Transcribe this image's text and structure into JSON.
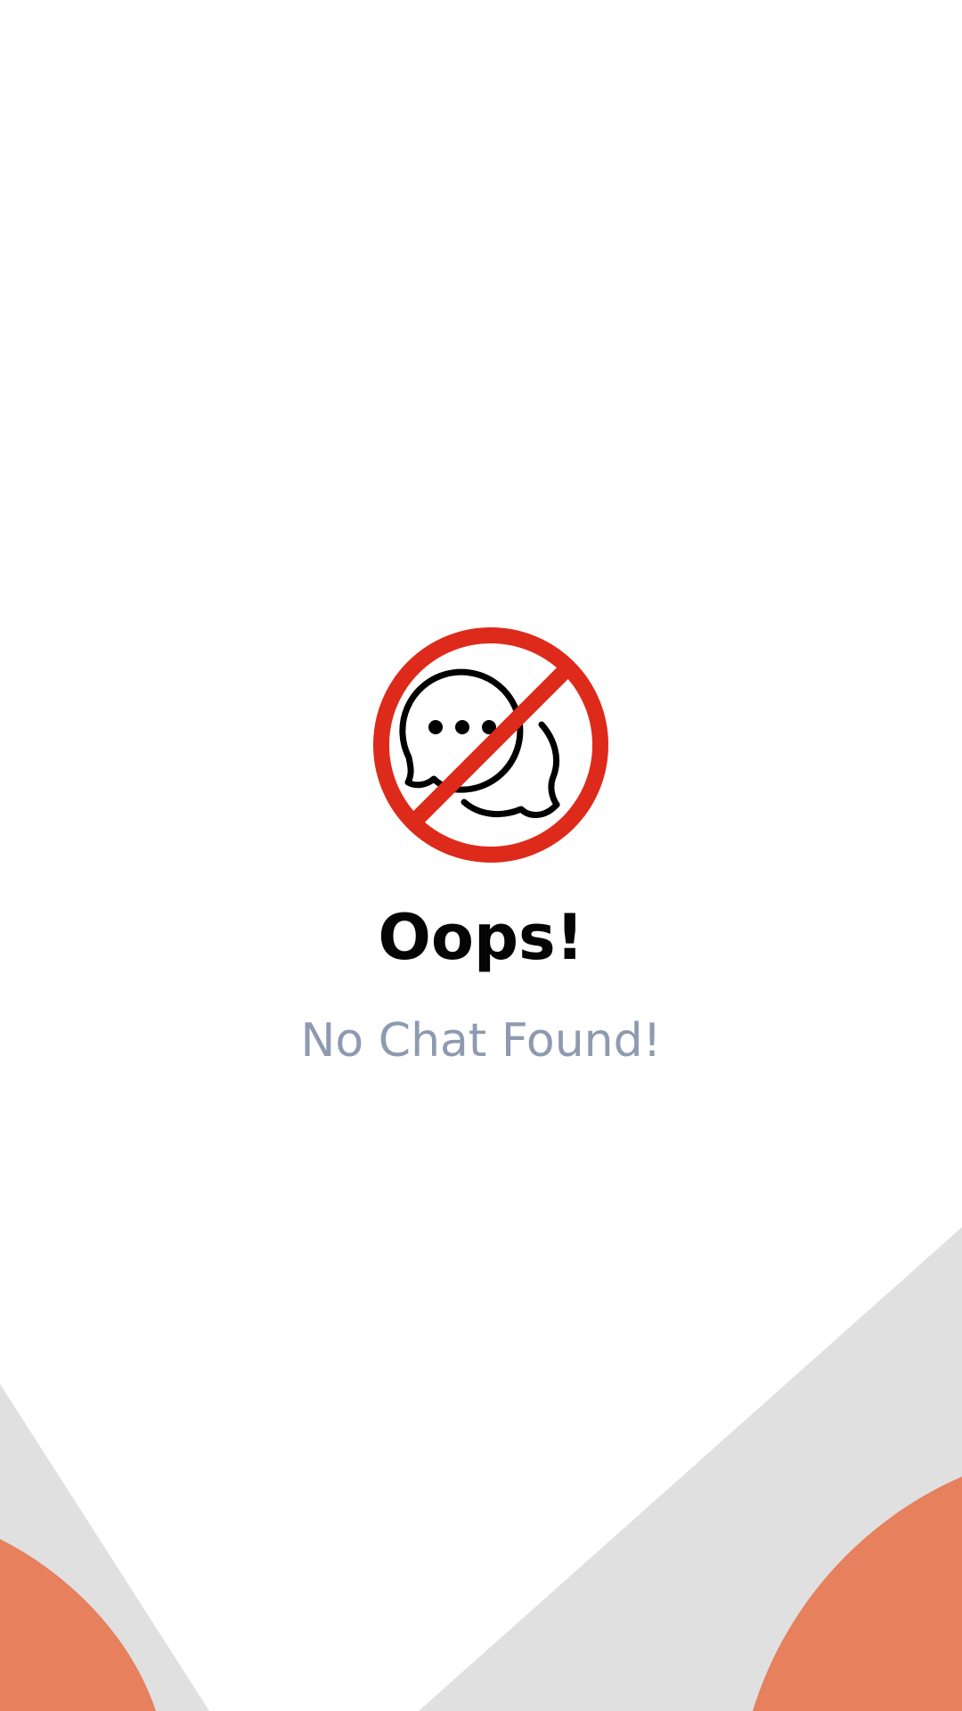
{
  "empty_state": {
    "icon": "no-chat-icon",
    "title": "Oops!",
    "message": "No Chat Found!"
  },
  "colors": {
    "background": "#ffffff",
    "accent": "#e05a3d",
    "decor_orange": "#e6805d",
    "decor_gray": "#e0e0e0",
    "prohibit_red": "#dd2a1b",
    "title": "#050505",
    "subtitle": "#8e9ab0"
  }
}
